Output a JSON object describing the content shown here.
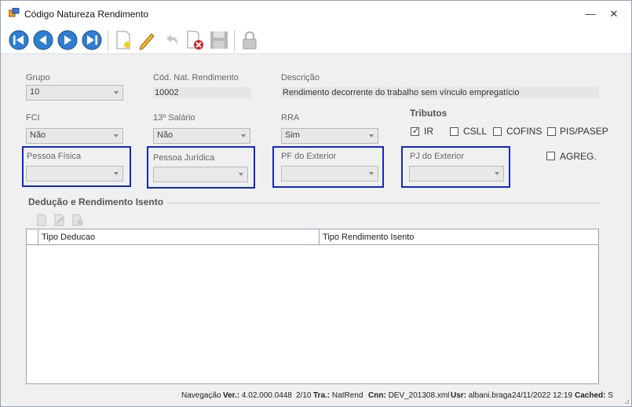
{
  "window": {
    "title": "Código Natureza Rendimento",
    "minimize_icon": "minimize-icon",
    "close_icon": "close-icon"
  },
  "toolbar": {
    "buttons": [
      "first-record",
      "previous-record",
      "next-record",
      "last-record",
      "new-record",
      "edit-record",
      "undo",
      "delete-record",
      "save-record",
      "lock"
    ]
  },
  "form": {
    "grupo": {
      "label": "Grupo",
      "value": "10"
    },
    "cod_nat": {
      "label": "Cód. Nat. Rendimento",
      "value": "10002"
    },
    "descricao": {
      "label": "Descrição",
      "value": "Rendimento decorrente do trabalho sem vínculo empregatício"
    },
    "fci": {
      "label": "FCI",
      "value": "Não"
    },
    "decimo_terceiro": {
      "label": "13º Salário",
      "value": "Não"
    },
    "rra": {
      "label": "RRA",
      "value": "Sim"
    },
    "pessoa_fisica": {
      "label": "Pessoa Física",
      "value": ""
    },
    "pessoa_juridica": {
      "label": "Pessoa Jurídica",
      "value": ""
    },
    "pf_exterior": {
      "label": "PF do Exterior",
      "value": ""
    },
    "pj_exterior": {
      "label": "PJ do Exterior",
      "value": ""
    }
  },
  "tributos": {
    "title": "Tributos",
    "items": [
      {
        "label": "IR",
        "checked": true
      },
      {
        "label": "CSLL",
        "checked": false
      },
      {
        "label": "COFINS",
        "checked": false
      },
      {
        "label": "PIS/PASEP",
        "checked": false
      },
      {
        "label": "AGREG.",
        "checked": false
      }
    ]
  },
  "deducao": {
    "title": "Dedução e Rendimento Isento",
    "columns": [
      "Tipo Deducao",
      "Tipo Rendimento Isento"
    ],
    "rows": []
  },
  "status": {
    "navegacao": "Navegação",
    "ver_label": "Ver.:",
    "ver_value": "4.02.000.0448",
    "page": "2/10",
    "tra_label": "Tra.:",
    "tra_value": "NatRend",
    "cnn_label": "Cnn:",
    "cnn_value": "DEV_201308.xml",
    "usr_label": "Usr:",
    "usr_value": "albani.braga",
    "datetime": "24/11/2022  12:19",
    "cached_label": "Cached:",
    "cached_value": "S"
  },
  "colors": {
    "highlight_border": "#1028c8",
    "window_bg": "#f0f0f0"
  }
}
